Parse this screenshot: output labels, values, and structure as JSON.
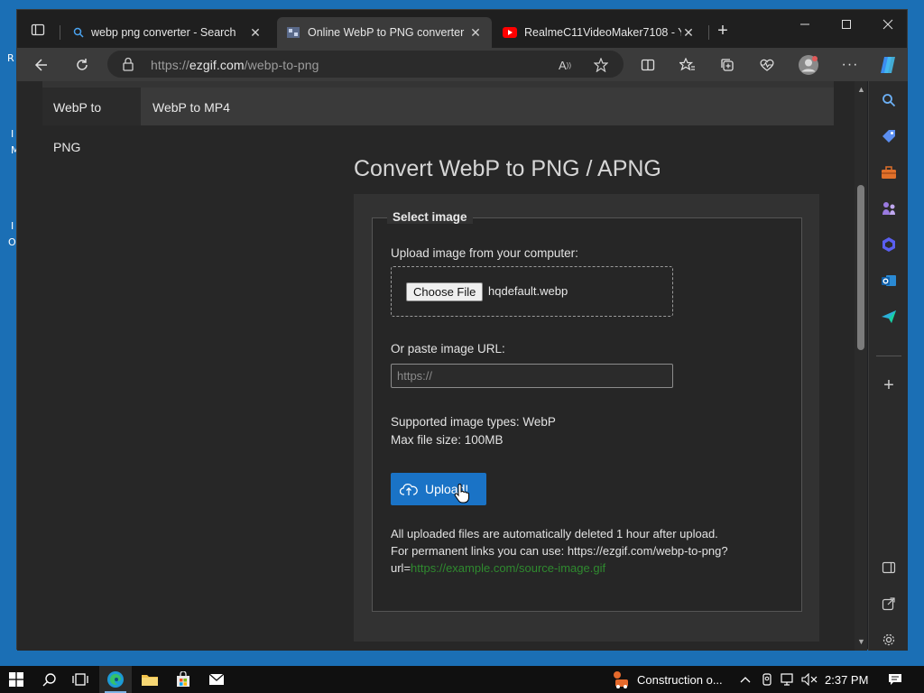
{
  "desktop": {
    "fragments": [
      "R",
      "I",
      "M",
      "I",
      "O"
    ]
  },
  "tabs": [
    {
      "label": "webp png converter - Search",
      "icon": "search-icon",
      "active": false
    },
    {
      "label": "Online WebP to PNG converter",
      "icon": "ezgif-favicon",
      "active": true
    },
    {
      "label": "RealmeC11VideoMaker7108 - Yo",
      "icon": "youtube-icon",
      "active": false
    }
  ],
  "address": {
    "prefix": "https://",
    "domain": "ezgif.com",
    "path": "/webp-to-png"
  },
  "page": {
    "nav": [
      "WebP to PNG",
      "WebP to MP4"
    ],
    "title": "Convert WebP to PNG / APNG",
    "legend": "Select image",
    "upload_label": "Upload image from your computer:",
    "choose_file": "Choose File",
    "filename": "hqdefault.webp",
    "url_label": "Or paste image URL:",
    "url_placeholder": "https://",
    "supported": "Supported image types: WebP",
    "max_size": "Max file size: 100MB",
    "upload_button": "Upload!",
    "note_line1": "All uploaded files are automatically deleted 1 hour after upload.",
    "note_line2": "For permanent links you can use: https://ezgif.com/webp-to-png?",
    "note_line3_prefix": "url=",
    "note_link": "https://example.com/source-image.gif"
  },
  "taskbar": {
    "notification_text": "Construction o...",
    "time": "2:37 PM"
  },
  "colors": {
    "accent": "#1a73c6",
    "link_green": "#2f8a2f",
    "desktop_blue": "#1b6fb5"
  }
}
